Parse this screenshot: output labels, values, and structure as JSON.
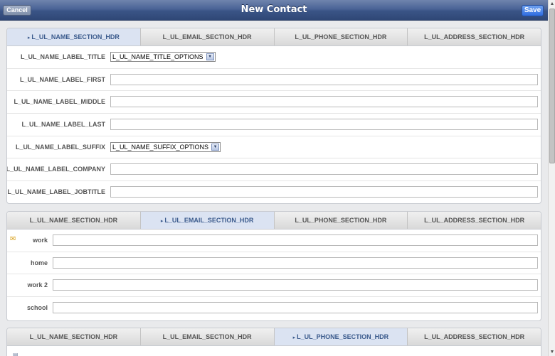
{
  "header": {
    "title": "New Contact",
    "cancel_label": "Cancel",
    "save_label": "Save"
  },
  "tabs": [
    "L_UL_NAME_SECTION_HDR",
    "L_UL_EMAIL_SECTION_HDR",
    "L_UL_PHONE_SECTION_HDR",
    "L_UL_ADDRESS_SECTION_HDR"
  ],
  "name_section": {
    "title_label": "L_UL_NAME_LABEL_TITLE",
    "title_select": "L_UL_NAME_TITLE_OPTIONS",
    "first_label": "L_UL_NAME_LABEL_FIRST",
    "middle_label": "L_UL_NAME_LABEL_MIDDLE",
    "last_label": "L_UL_NAME_LABEL_LAST",
    "suffix_label": "L_UL_NAME_LABEL_SUFFIX",
    "suffix_select": "L_UL_NAME_SUFFIX_OPTIONS",
    "company_label": "L_UL_NAME_LABEL_COMPANY",
    "jobtitle_label": "L_UL_NAME_LABEL_JOBTITLE"
  },
  "email_section": {
    "work_label": "work",
    "home_label": "home",
    "work2_label": "work 2",
    "school_label": "school"
  },
  "icons": {
    "primary": "star-icon",
    "phone": "phone-icon"
  }
}
